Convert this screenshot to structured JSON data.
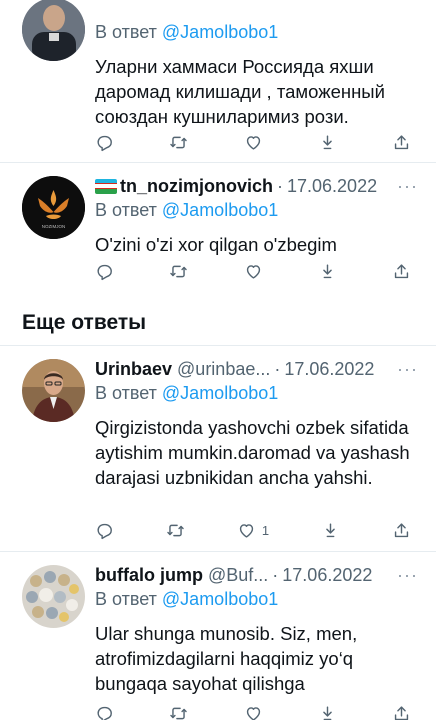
{
  "tweets": [
    {
      "reply_prefix": "В ответ",
      "reply_to": "@Jamolbobo1",
      "text": "Уларни хаммаси Россияда яхши даромад килишади , таможенный союздан кушниларимиз рози.",
      "likes": ""
    },
    {
      "name": "tn_nozimjonovich",
      "date": "17.06.2022",
      "more": "···",
      "reply_prefix": "В ответ",
      "reply_to": "@Jamolbobo1",
      "text": "O'zini o'zi xor qilgan o'zbegim",
      "avatar_text": "NOZIMJON"
    },
    {
      "name": "Urinbaev",
      "handle": "@urinbae...",
      "date": "17.06.2022",
      "more": "···",
      "reply_prefix": "В ответ",
      "reply_to": "@Jamolbobo1",
      "text": "Qirgizistonda yashovchi ozbek sifatida aytishim mumkin.daromad va yashash darajasi uzbnikidan ancha yahshi.",
      "likes": "1"
    },
    {
      "name": "buffalo jump",
      "handle": "@Buf...",
      "date": "17.06.2022",
      "more": "···",
      "reply_prefix": "В ответ",
      "reply_to": "@Jamolbobo1",
      "text": "Ular shunga munosib. Siz, men, atrofimizdagilarni haqqimiz yo‘q bungaqa sayohat qilishga"
    }
  ],
  "section": {
    "title": "Еще ответы"
  },
  "colors": {
    "accent": "#1d9bf0",
    "muted": "#536471",
    "text": "#0f1419",
    "divider": "#e6ecf0"
  },
  "icons": [
    "reply-icon",
    "retweet-icon",
    "like-icon",
    "download-icon",
    "share-icon"
  ]
}
